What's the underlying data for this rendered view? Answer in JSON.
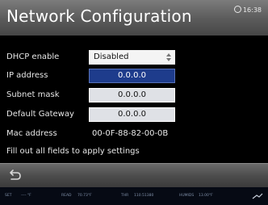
{
  "header": {
    "title": "Network Configuration",
    "time": "16:38"
  },
  "form": {
    "dhcp": {
      "label": "DHCP enable",
      "value": "Disabled"
    },
    "ip": {
      "label": "IP address",
      "value": "0.0.0.0"
    },
    "subnet": {
      "label": "Subnet mask",
      "value": "0.0.0.0"
    },
    "gateway": {
      "label": "Default Gateway",
      "value": "0.0.0.0"
    },
    "mac": {
      "label": "Mac address",
      "value": "00-0F-88-82-00-0B"
    }
  },
  "hint": "Fill out all fields to apply settings",
  "status": {
    "set_label": "SET",
    "set_value": "---- °F",
    "read_label": "READ",
    "read_value": "70.73°F",
    "thr_label": "THR",
    "thr_value": "110.51380",
    "humidity_label": "HUMIDS",
    "humidity_value": "13.00°F"
  },
  "icons": {
    "clock": "clock-icon",
    "back": "back-arrow-icon",
    "spinner": "up-down-spinner-icon",
    "network": "network-signal-icon"
  }
}
